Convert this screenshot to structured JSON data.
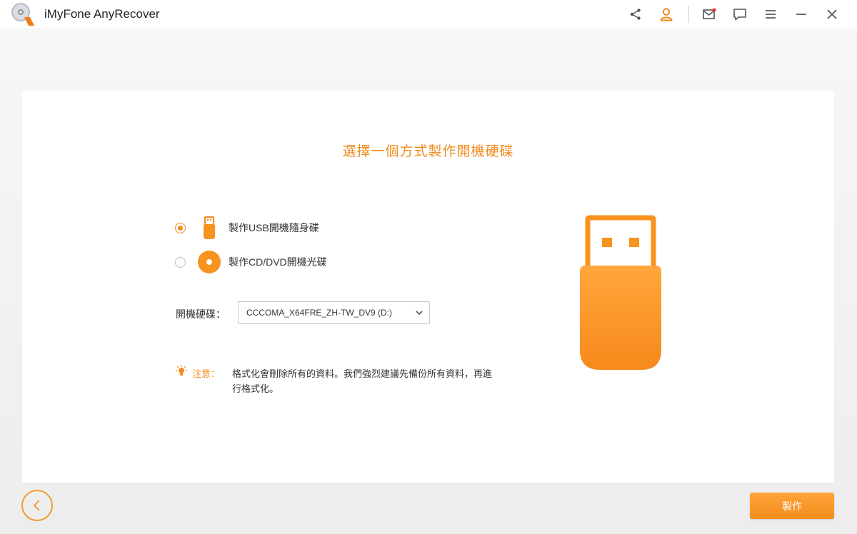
{
  "app": {
    "title": "iMyFone AnyRecover"
  },
  "toolbar": {
    "icons": [
      "share-icon",
      "user-icon",
      "mail-icon",
      "feedback-icon",
      "menu-icon",
      "minimize-icon",
      "close-icon"
    ]
  },
  "main": {
    "heading": "選擇一個方式製作開機硬碟",
    "options": [
      {
        "label": "製作USB開機隨身碟",
        "selected": true,
        "icon": "usb-drive-icon"
      },
      {
        "label": "製作CD/DVD開機光碟",
        "selected": false,
        "icon": "cd-dvd-icon"
      }
    ],
    "drive": {
      "label": "開機硬碟：",
      "selected": "CCCOMA_X64FRE_ZH-TW_DV9 (D:)"
    },
    "note": {
      "label": "注意：",
      "text": "格式化會刪除所有的資料。我們強烈建議先備份所有資料，再進行格式化。"
    }
  },
  "footer": {
    "make_label": "製作"
  },
  "colors": {
    "accent": "#f08c1e",
    "button": "#f7931f"
  }
}
